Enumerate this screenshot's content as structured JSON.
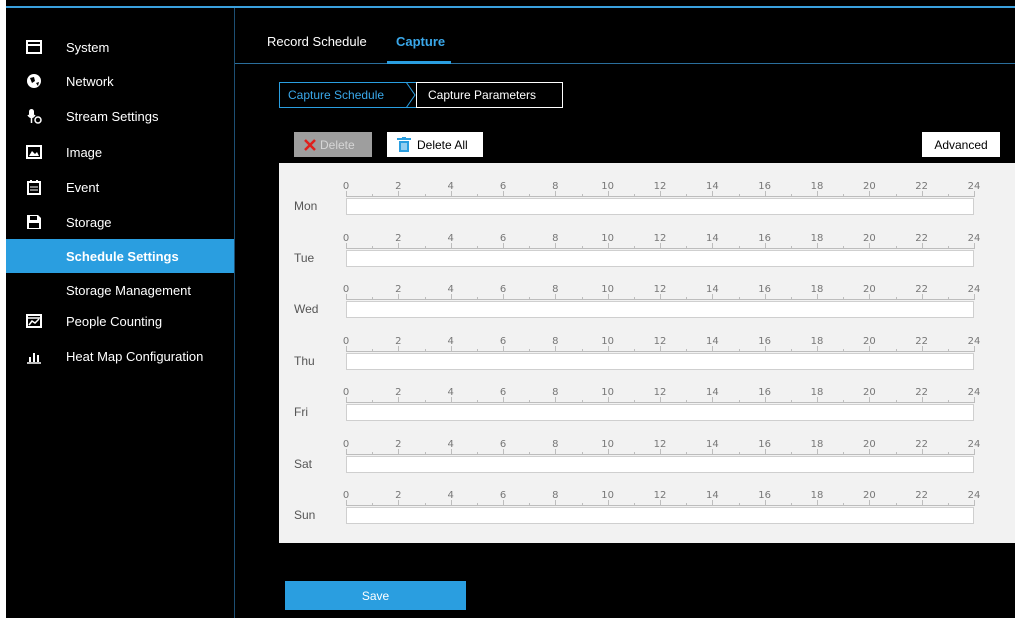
{
  "sidebar": {
    "items": [
      {
        "label": "System",
        "icon": "monitor-icon"
      },
      {
        "label": "Network",
        "icon": "globe-icon"
      },
      {
        "label": "Stream Settings",
        "icon": "camera-settings-icon"
      },
      {
        "label": "Image",
        "icon": "image-icon"
      },
      {
        "label": "Event",
        "icon": "calendar-icon"
      },
      {
        "label": "Storage",
        "icon": "save-icon"
      },
      {
        "label": "Schedule Settings",
        "icon": ""
      },
      {
        "label": "Storage Management",
        "icon": ""
      },
      {
        "label": "People Counting",
        "icon": "people-chart-icon"
      },
      {
        "label": "Heat Map Configuration",
        "icon": "bar-chart-icon"
      }
    ],
    "active": "Schedule Settings"
  },
  "tabs": [
    {
      "label": "Record Schedule"
    },
    {
      "label": "Capture"
    }
  ],
  "active_tab": "Capture",
  "subtabs": [
    {
      "label": "Capture Schedule"
    },
    {
      "label": "Capture Parameters"
    }
  ],
  "toolbar": {
    "delete_label": "Delete",
    "delete_all_label": "Delete All",
    "advanced_label": "Advanced"
  },
  "schedule": {
    "hours": [
      "0",
      "2",
      "4",
      "6",
      "8",
      "10",
      "12",
      "14",
      "16",
      "18",
      "20",
      "22",
      "24"
    ],
    "days": [
      "Mon",
      "Tue",
      "Wed",
      "Thu",
      "Fri",
      "Sat",
      "Sun"
    ]
  },
  "save_label": "Save",
  "colors": {
    "accent": "#2a9ee0",
    "background": "#000000",
    "panel": "#f2f2f2"
  }
}
